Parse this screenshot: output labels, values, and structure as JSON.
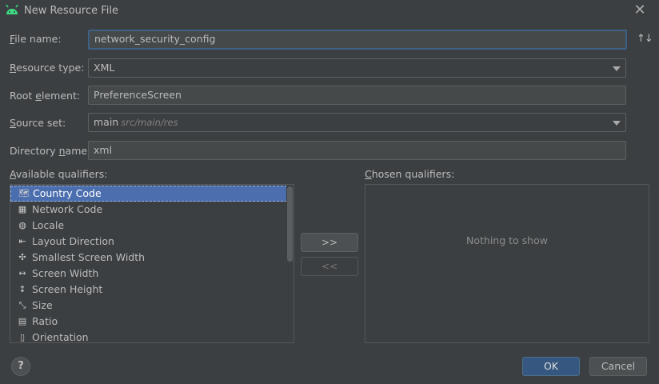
{
  "window": {
    "title": "New Resource File",
    "app_icon": "android-icon",
    "close_icon": "close-icon"
  },
  "form": {
    "file_name": {
      "label": "File name:",
      "mnemonic": "F",
      "label_rest": "ile name:",
      "value": "network_security_config"
    },
    "resource_type": {
      "label": "Resource type:",
      "mnemonic": "R",
      "label_rest": "esource type:",
      "value": "XML"
    },
    "root_element": {
      "label": "Root element:",
      "label_pre": "Root ",
      "mnemonic": "e",
      "label_rest": "lement:",
      "value": "PreferenceScreen"
    },
    "source_set": {
      "label": "Source set:",
      "mnemonic": "S",
      "label_rest": "ource set:",
      "value": "main",
      "hint": "src/main/res"
    },
    "directory_name": {
      "label": "Directory name:",
      "label_pre": "Directory ",
      "mnemonic": "n",
      "label_rest": "ame:",
      "value": "xml"
    },
    "sort_icon": "sort-arrows-icon"
  },
  "qualifiers": {
    "available_label": "Available qualifiers:",
    "available_mnemonic": "A",
    "available_rest": "vailable qualifiers:",
    "chosen_label": "Chosen qualifiers:",
    "chosen_mnemonic": "C",
    "chosen_rest": "hosen qualifiers:",
    "items": [
      {
        "label": "Country Code",
        "icon": "country-code-icon",
        "glyph": "🗺",
        "selected": true
      },
      {
        "label": "Network Code",
        "icon": "network-code-icon",
        "glyph": "▦",
        "selected": false
      },
      {
        "label": "Locale",
        "icon": "globe-icon",
        "glyph": "◍",
        "selected": false
      },
      {
        "label": "Layout Direction",
        "icon": "layout-direction-icon",
        "glyph": "⇤",
        "selected": false
      },
      {
        "label": "Smallest Screen Width",
        "icon": "smallest-width-icon",
        "glyph": "✣",
        "selected": false
      },
      {
        "label": "Screen Width",
        "icon": "screen-width-icon",
        "glyph": "↔",
        "selected": false
      },
      {
        "label": "Screen Height",
        "icon": "screen-height-icon",
        "glyph": "↕",
        "selected": false
      },
      {
        "label": "Size",
        "icon": "size-icon",
        "glyph": "⤡",
        "selected": false
      },
      {
        "label": "Ratio",
        "icon": "ratio-icon",
        "glyph": "▤",
        "selected": false
      },
      {
        "label": "Orientation",
        "icon": "orientation-icon",
        "glyph": "▯",
        "selected": false
      }
    ],
    "add_button": ">>",
    "remove_button": "<<",
    "empty_text": "Nothing to show"
  },
  "footer": {
    "help_button": "?",
    "ok_button": "OK",
    "cancel_button": "Cancel"
  },
  "colors": {
    "background": "#3c3f41",
    "selection": "#4b6eaf",
    "ok_button": "#365880",
    "focus_border": "#3d6185"
  }
}
